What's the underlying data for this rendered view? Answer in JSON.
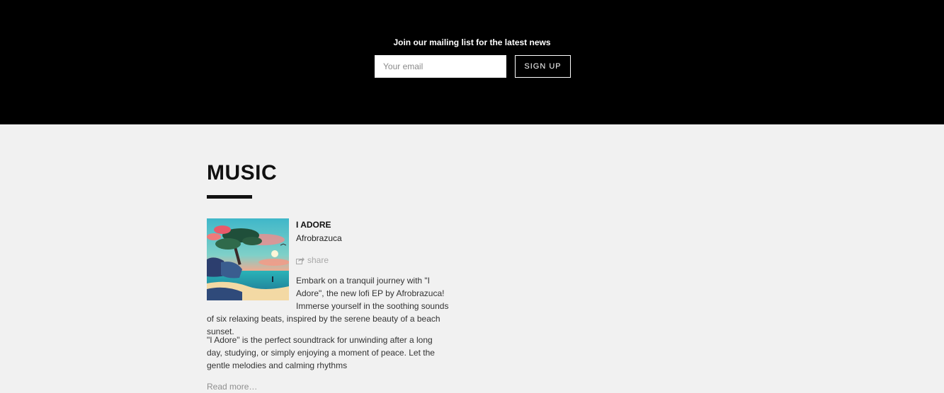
{
  "mailing": {
    "title": "Join our mailing list for the latest news",
    "email_placeholder": "Your email",
    "signup_label": "SIGN UP"
  },
  "music": {
    "heading": "MUSIC",
    "track": {
      "title": "I ADORE",
      "artist": "Afrobrazuca",
      "share_label": "share",
      "share_icon": "share-icon",
      "description_1": "Embark on a tranquil journey with \"I Adore\", the new lofi EP by Afrobrazuca! Immerse yourself in the soothing sounds of six relaxing beats, inspired by the serene beauty of a beach sunset.",
      "description_2": "\"I Adore\" is the perfect soundtrack for unwinding after a long day, studying, or simply enjoying a moment of peace. Let the gentle melodies and calming rhythms",
      "read_more": "Read more…"
    }
  },
  "colors": {
    "header_bg": "#000000",
    "page_bg": "#f1f1f1",
    "text": "#111111",
    "muted": "#a8a8a8"
  }
}
